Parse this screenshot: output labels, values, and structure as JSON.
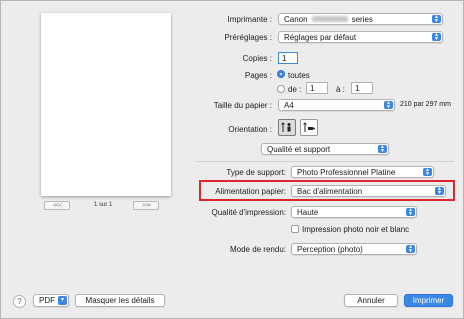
{
  "printer": {
    "label": "Imprimante :",
    "value_prefix": "Canon",
    "value_suffix": "series"
  },
  "presets": {
    "label": "Préréglages :",
    "value": "Réglages par défaut"
  },
  "copies": {
    "label": "Copies :",
    "value": "1"
  },
  "pages": {
    "label": "Pages :",
    "all_label": "toutes",
    "range_from_label": "de :",
    "range_from": "1",
    "range_to_label": "à :",
    "range_to": "1"
  },
  "paper_size": {
    "label": "Taille du papier :",
    "value": "A4",
    "dimensions": "210 par 297 mm"
  },
  "orientation": {
    "label": "Orientation :"
  },
  "section": {
    "value": "Qualité et support"
  },
  "media_type": {
    "label": "Type de support:",
    "value": "Photo Professionnel Platine"
  },
  "paper_source": {
    "label": "Alimentation papier:",
    "value": "Bac d'alimentation"
  },
  "print_quality": {
    "label": "Qualité d'impression:",
    "value": "Haute"
  },
  "grayscale": {
    "label": "Impression photo noir et blanc",
    "checked": false
  },
  "rendering_mode": {
    "label": "Mode de rendu:",
    "value": "Perception (photo)"
  },
  "preview": {
    "page_count": "1 sur 1"
  },
  "footer": {
    "help": "?",
    "pdf": "PDF",
    "hide_details": "Masquer les détails",
    "cancel": "Annuler",
    "print": "Imprimer"
  },
  "colors": {
    "accent": "#3b87e6",
    "highlight": "#e0262a",
    "background": "#ececec"
  }
}
